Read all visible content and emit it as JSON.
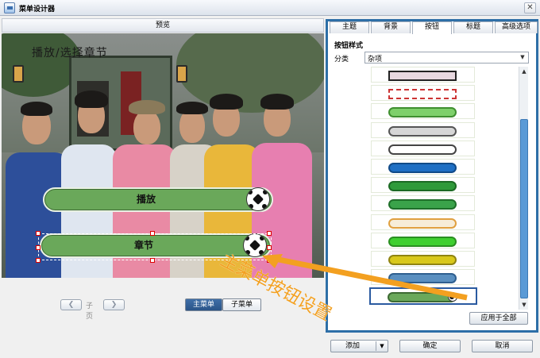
{
  "window": {
    "title": "菜单设计器",
    "close_glyph": "✕"
  },
  "preview": {
    "header": "预览",
    "overlay_text": "播放/选择章节",
    "buttons": [
      {
        "label": "播放"
      },
      {
        "label": "章节"
      }
    ]
  },
  "pager": {
    "prev_glyph": "❮",
    "label": "子页",
    "next_glyph": "❯"
  },
  "menu_toggle": {
    "main": "主菜单",
    "sub": "子菜单",
    "selected": "主菜单"
  },
  "tabs": [
    {
      "label": "主题"
    },
    {
      "label": "背景"
    },
    {
      "label": "按钮"
    },
    {
      "label": "标题"
    },
    {
      "label": "高级选项"
    }
  ],
  "active_tab": "按钮",
  "button_style": {
    "group_title": "按钮样式",
    "category_label": "分类",
    "category_value": "杂项",
    "styles": [
      {
        "name": "pink-rect-dark-border",
        "fill": "#e8d8e0",
        "border": "#222222"
      },
      {
        "name": "white-rect-red-dash",
        "fill": "#ffffff",
        "border": "#cc3333"
      },
      {
        "name": "light-green-hex",
        "fill": "#7ed06a",
        "border": "#3f8f2f"
      },
      {
        "name": "grey-hex",
        "fill": "#d6d6d6",
        "border": "#555555"
      },
      {
        "name": "white-rounded",
        "fill": "#ffffff",
        "border": "#444444"
      },
      {
        "name": "blue-pill-orange-cap",
        "fill": "#1f6fc4",
        "border": "#114a88"
      },
      {
        "name": "green-pill-orange-caps",
        "fill": "#2f9a3a",
        "border": "#1c6a24"
      },
      {
        "name": "green-pill-white-dot",
        "fill": "#3aa34a",
        "border": "#1f6f2a"
      },
      {
        "name": "cream-arrow-orange-border",
        "fill": "#f7edd8",
        "border": "#e0a040"
      },
      {
        "name": "bright-green-bar",
        "fill": "#3fcf2f",
        "border": "#2a8f20"
      },
      {
        "name": "yellow-bar",
        "fill": "#d8c81a",
        "border": "#8f8410"
      },
      {
        "name": "steel-blue-bar",
        "fill": "#5a8fc0",
        "border": "#2f5f8f"
      },
      {
        "name": "green-pill-soccer-ball",
        "fill": "#6aa85a",
        "border": "#3d6a33"
      }
    ],
    "selected_index": 12,
    "apply_all": "应用于全部"
  },
  "footer": {
    "add": "添加",
    "ok": "确定",
    "cancel": "取消"
  },
  "annotation": {
    "text": "主菜单按钮设置",
    "color": "#f3a020"
  },
  "colors": {
    "accent": "#2e6fa7",
    "selected_segment": "#2a5488"
  }
}
